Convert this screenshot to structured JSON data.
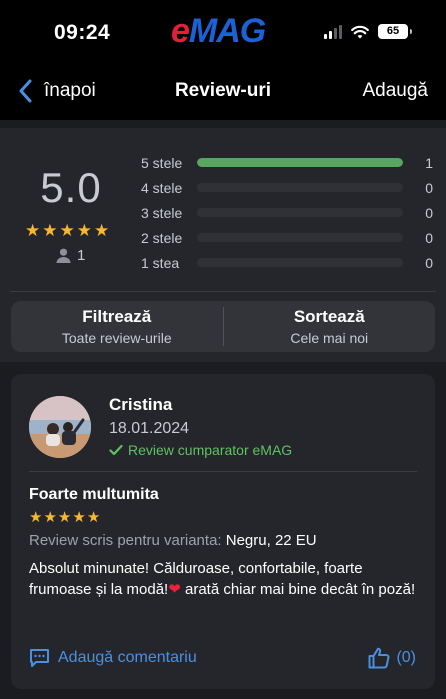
{
  "status_bar": {
    "time": "09:24",
    "battery": "65"
  },
  "app": {
    "logo_e": "e",
    "logo_mag": "MAG",
    "brand_red": "#e61e3a",
    "brand_blue": "#1a62d6"
  },
  "nav": {
    "back_label": "înapoi",
    "title": "Review-uri",
    "add_label": "Adaugă"
  },
  "summary": {
    "average": "5.0",
    "average_stars": 5,
    "reviews_count": "1",
    "distribution": [
      {
        "label": "5 stele",
        "count": "1",
        "fraction": 1.0
      },
      {
        "label": "4 stele",
        "count": "0",
        "fraction": 0
      },
      {
        "label": "3 stele",
        "count": "0",
        "fraction": 0
      },
      {
        "label": "2 stele",
        "count": "0",
        "fraction": 0
      },
      {
        "label": "1 stea",
        "count": "0",
        "fraction": 0
      }
    ],
    "filter": {
      "title": "Filtrează",
      "subtitle": "Toate review-urile"
    },
    "sort": {
      "title": "Sortează",
      "subtitle": "Cele mai noi"
    }
  },
  "review": {
    "author": "Cristina",
    "date": "18.01.2024",
    "verified_label": "Review cumparator eMAG",
    "title": "Foarte multumita",
    "stars": 5,
    "variant_label": "Review scris pentru varianta:",
    "variant_value": "Negru, 22 EU",
    "text_before_heart": "Absolut minunate! Călduroase, confortabile, foarte frumoase și la modă!",
    "text_after_heart": " arată chiar mai bine decât în poză!",
    "comment_label": "Adaugă comentariu",
    "likes": "(0)"
  },
  "colors": {
    "accent_blue": "#4a90e2",
    "star_gold": "#f5b82e",
    "bar_green": "#5aa55f",
    "verified_green": "#5fc065"
  },
  "icons": {
    "back": "chevron-left-icon",
    "user": "user-icon",
    "check": "check-icon",
    "comment": "comment-icon",
    "like": "thumbs-up-icon",
    "heart": "heart-icon"
  }
}
